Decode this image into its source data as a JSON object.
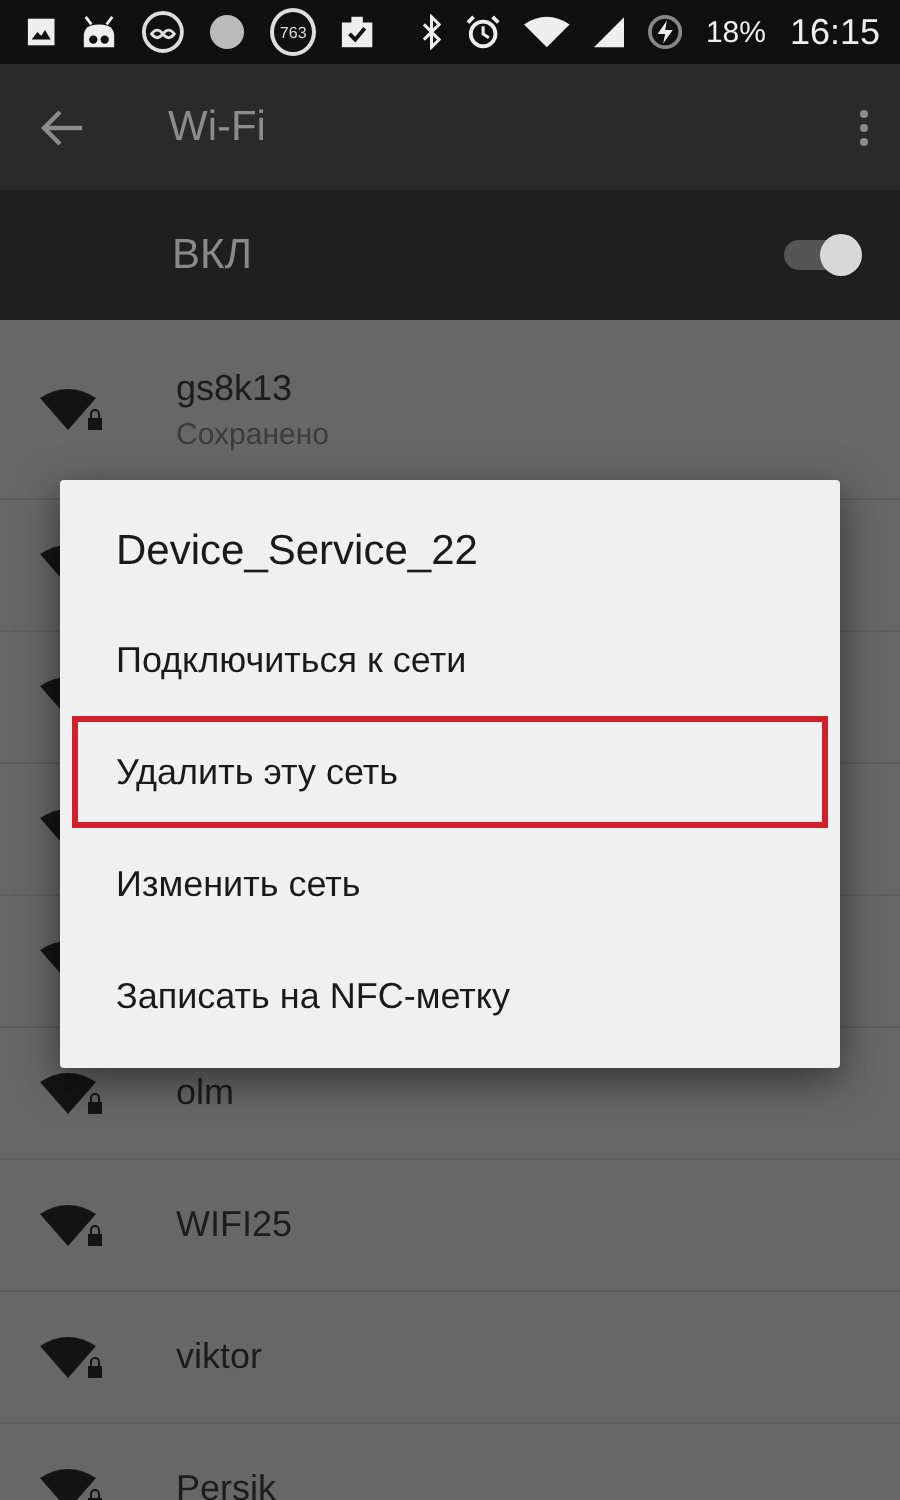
{
  "status_bar": {
    "notification_badge": "763",
    "battery": "18%",
    "time": "16:15"
  },
  "toolbar": {
    "title": "Wi-Fi"
  },
  "wifi_switch": {
    "label": "ВКЛ",
    "on": true
  },
  "networks": [
    {
      "kind": "network",
      "name": "gs8k13",
      "status": "Сохранено",
      "secured": true
    },
    {
      "kind": "covered"
    },
    {
      "kind": "covered"
    },
    {
      "kind": "covered"
    },
    {
      "kind": "covered"
    },
    {
      "kind": "network",
      "name": "olm",
      "secured": true
    },
    {
      "kind": "network",
      "name": "WIFI25",
      "secured": true
    },
    {
      "kind": "network",
      "name": "viktor",
      "secured": true
    },
    {
      "kind": "network",
      "name": "Persik",
      "secured": true
    }
  ],
  "dialog": {
    "title": "Device_Service_22",
    "items": [
      {
        "label": "Подключиться к сети",
        "highlighted": false
      },
      {
        "label": "Удалить эту сеть",
        "highlighted": true
      },
      {
        "label": "Изменить сеть",
        "highlighted": false
      },
      {
        "label": "Записать на NFC-метку",
        "highlighted": false
      }
    ]
  }
}
